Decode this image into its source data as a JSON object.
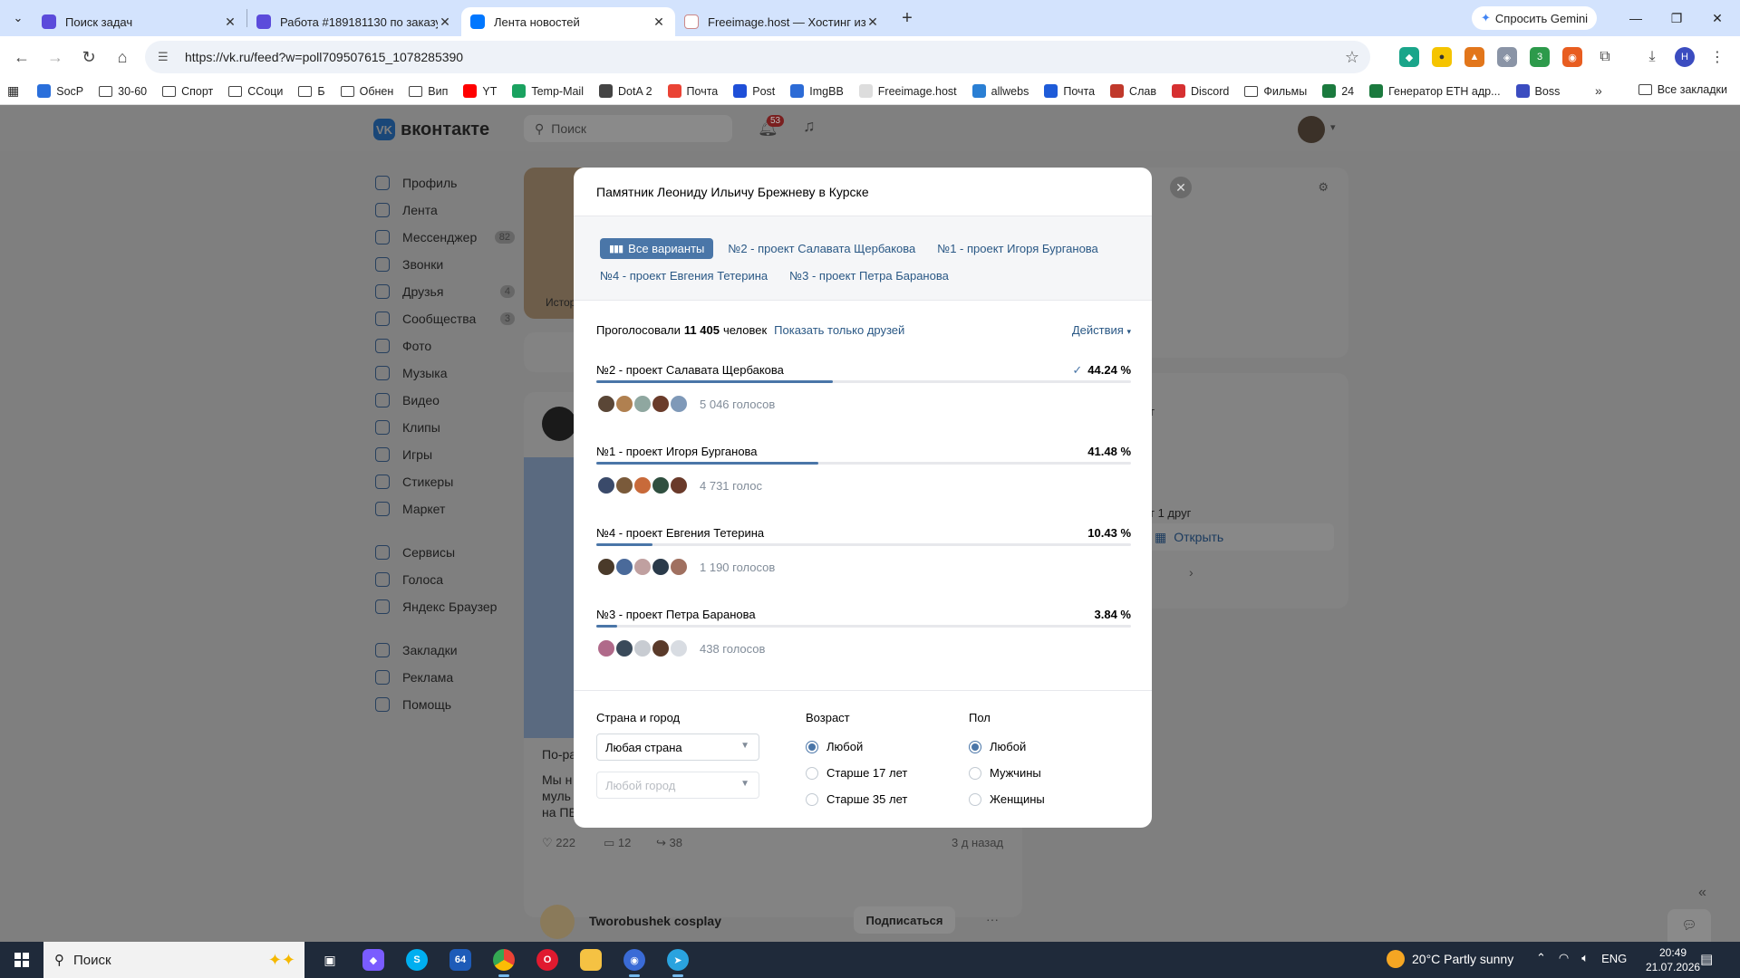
{
  "browser": {
    "tabs": [
      {
        "title": "Поиск задач",
        "color": "#5b4bdb",
        "active": false
      },
      {
        "title": "Работа #189181130 по заказу",
        "color": "#5b4bdb",
        "active": false
      },
      {
        "title": "Лента новостей",
        "color": "#0077ff",
        "active": true
      },
      {
        "title": "Freeimage.host — Хостинг изо",
        "color": "#e8eef8",
        "active": false
      }
    ],
    "gemini_label": "Спросить Gemini",
    "url": "https://vk.ru/feed?w=poll709507615_1078285390",
    "bookmarks": [
      {
        "label": "SocP",
        "type": "icon",
        "color": "#2a6fdb"
      },
      {
        "label": "30-60",
        "type": "folder"
      },
      {
        "label": "Спорт",
        "type": "folder"
      },
      {
        "label": "ССоци",
        "type": "folder"
      },
      {
        "label": "Б",
        "type": "folder"
      },
      {
        "label": "Обнен",
        "type": "folder"
      },
      {
        "label": "Вип",
        "type": "folder"
      },
      {
        "label": "YT",
        "type": "icon",
        "color": "#ff0000"
      },
      {
        "label": "Temp-Mail",
        "type": "icon",
        "color": "#1aa260"
      },
      {
        "label": "DotA 2",
        "type": "icon",
        "color": "#444444"
      },
      {
        "label": "Почта",
        "type": "icon",
        "color": "#ea4335"
      },
      {
        "label": "Post",
        "type": "icon",
        "color": "#1e4fd8"
      },
      {
        "label": "ImgBB",
        "type": "icon",
        "color": "#2c6bd6"
      },
      {
        "label": "Freeimage.host",
        "type": "icon",
        "color": "#dddddd"
      },
      {
        "label": "allwebs",
        "type": "icon",
        "color": "#2a7fd4"
      },
      {
        "label": "Почта",
        "type": "icon",
        "color": "#1e5bd8"
      },
      {
        "label": "Слав",
        "type": "icon",
        "color": "#c0392b"
      },
      {
        "label": "Discord",
        "type": "icon",
        "color": "#d63031"
      },
      {
        "label": "Фильмы",
        "type": "folder"
      },
      {
        "label": "24",
        "type": "icon",
        "color": "#1b7a3e"
      },
      {
        "label": "Генератор ETH адр...",
        "type": "icon",
        "color": "#1b7a3e"
      },
      {
        "label": "Boss",
        "type": "icon",
        "color": "#3b4cc0"
      }
    ],
    "all_bookmarks": "Все закладки",
    "ext_badge": "3",
    "profile_letter": "Н"
  },
  "vk": {
    "logo": "вконтакте",
    "search_placeholder": "Поиск",
    "notif_count": "53",
    "nav": [
      {
        "label": "Профиль"
      },
      {
        "label": "Лента"
      },
      {
        "label": "Мессенджер",
        "count": "82"
      },
      {
        "label": "Звонки"
      },
      {
        "label": "Друзья",
        "count": "4"
      },
      {
        "label": "Сообщества",
        "count": "3"
      },
      {
        "label": "Фото"
      },
      {
        "label": "Музыка"
      },
      {
        "label": "Видео"
      },
      {
        "label": "Клипы"
      },
      {
        "label": "Игры"
      },
      {
        "label": "Стикеры"
      },
      {
        "label": "Маркет"
      }
    ],
    "nav2": [
      {
        "label": "Сервисы"
      },
      {
        "label": "Голоса"
      },
      {
        "label": "Яндекс Браузер"
      }
    ],
    "nav3": [
      {
        "label": "Закладки"
      },
      {
        "label": "Реклама"
      },
      {
        "label": "Помощь"
      }
    ],
    "feed": {
      "stories_label": "Истор",
      "post_title": "По-ра",
      "post_line1": "Мы н",
      "post_line2": "муль",
      "post_line3": "на ПЕ",
      "likes": "222",
      "comments": "12",
      "shares": "38",
      "time": "3 д назад",
      "next_author": "Tworobushek cosplay",
      "subscribe": "Подписаться"
    },
    "right": {
      "friend_text": "т 1 друг",
      "open": "Открыть",
      "frag": "т"
    }
  },
  "poll": {
    "title": "Памятник Леониду Ильичу Брежневу в Курске",
    "tabs_row1": [
      "Все варианты",
      "№2 - проект Салавата Щербакова",
      "№1 - проект Игоря Бурганова"
    ],
    "tabs_row2": [
      "№4 - проект Евгения Тетерина",
      "№3 - проект Петра Баранова"
    ],
    "voted_prefix": "Проголосовали",
    "voted_count": "11 405",
    "voted_suffix": "человек",
    "friends_only": "Показать только друзей",
    "actions": "Действия",
    "options": [
      {
        "label": "№2 - проект Салавата Щербакова",
        "percent_text": "44.24 %",
        "percent": 44.24,
        "votes": "5 046 голосов",
        "checked": true,
        "avatars": [
          "#5a4636",
          "#b08050",
          "#8fa7a0",
          "#6a3b2a",
          "#7f99b8"
        ]
      },
      {
        "label": "№1 - проект Игоря Бурганова",
        "percent_text": "41.48 %",
        "percent": 41.48,
        "votes": "4 731 голос",
        "checked": false,
        "avatars": [
          "#3a4a6a",
          "#7a5a3a",
          "#c86a3a",
          "#2f4f3f",
          "#6a3a2a"
        ]
      },
      {
        "label": "№4 - проект Евгения Тетерина",
        "percent_text": "10.43 %",
        "percent": 10.43,
        "votes": "1 190 голосов",
        "checked": false,
        "avatars": [
          "#4a3a2a",
          "#4a6a9a",
          "#c0a0a0",
          "#2a3a4a",
          "#a07060"
        ]
      },
      {
        "label": "№3 - проект Петра Баранова",
        "percent_text": "3.84 %",
        "percent": 3.84,
        "votes": "438 голосов",
        "checked": false,
        "avatars": [
          "#b06a8a",
          "#3a4a5a",
          "#c8ccd2",
          "#5a3a2a",
          "#d8dce2"
        ]
      }
    ],
    "filters": {
      "country_header": "Страна и город",
      "country_value": "Любая страна",
      "city_placeholder": "Любой город",
      "age_header": "Возраст",
      "age_options": [
        "Любой",
        "Старше 17 лет",
        "Старше 35 лет"
      ],
      "gender_header": "Пол",
      "gender_options": [
        "Любой",
        "Мужчины",
        "Женщины"
      ]
    }
  },
  "taskbar": {
    "search": "Поиск",
    "weather": "20°C  Partly sunny",
    "lang": "ENG",
    "time": "20:49",
    "date": "21.07.2026",
    "badge_64": "64"
  }
}
